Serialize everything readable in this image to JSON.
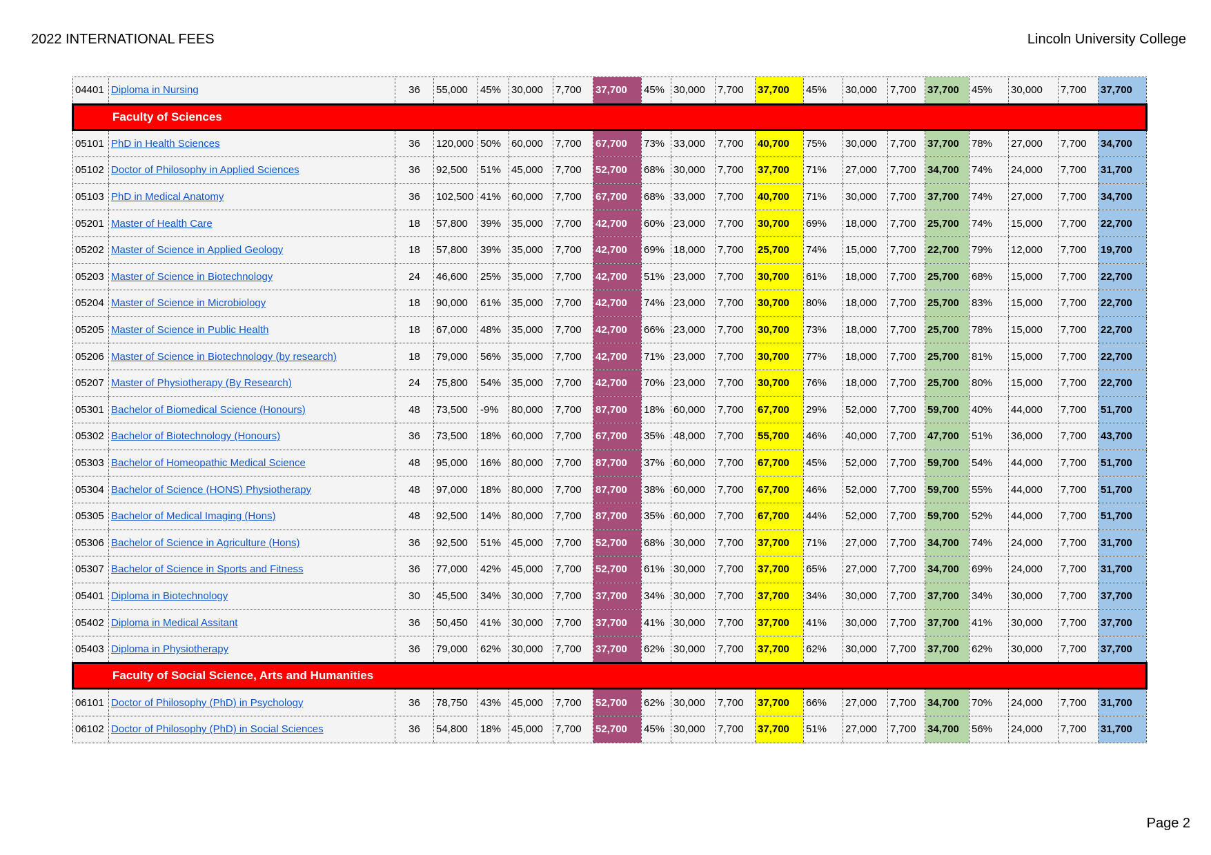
{
  "header": {
    "title": "2022 INTERNATIONAL FEES",
    "institution": "Lincoln University College"
  },
  "footer": {
    "page": "Page 2"
  },
  "rows": [
    {
      "type": "program",
      "cells": [
        "04401",
        "Diploma in Nursing",
        "36",
        "55,000",
        "45%",
        "30,000",
        "7,700",
        "37,700",
        "45%",
        "30,000",
        "7,700",
        "37,700",
        "45%",
        "30,000",
        "7,700",
        "37,700",
        "45%",
        "30,000",
        "7,700",
        "37,700"
      ]
    },
    {
      "type": "faculty",
      "label": "Faculty of Sciences"
    },
    {
      "type": "program",
      "cells": [
        "05101",
        "PhD in Health Sciences",
        "36",
        "120,000",
        "50%",
        "60,000",
        "7,700",
        "67,700",
        "73%",
        "33,000",
        "7,700",
        "40,700",
        "75%",
        "30,000",
        "7,700",
        "37,700",
        "78%",
        "27,000",
        "7,700",
        "34,700"
      ]
    },
    {
      "type": "program",
      "cells": [
        "05102",
        "Doctor of Philosophy in Applied Sciences",
        "36",
        "92,500",
        "51%",
        "45,000",
        "7,700",
        "52,700",
        "68%",
        "30,000",
        "7,700",
        "37,700",
        "71%",
        "27,000",
        "7,700",
        "34,700",
        "74%",
        "24,000",
        "7,700",
        "31,700"
      ]
    },
    {
      "type": "program",
      "cells": [
        "05103",
        "PhD in Medical Anatomy",
        "36",
        "102,500",
        "41%",
        "60,000",
        "7,700",
        "67,700",
        "68%",
        "33,000",
        "7,700",
        "40,700",
        "71%",
        "30,000",
        "7,700",
        "37,700",
        "74%",
        "27,000",
        "7,700",
        "34,700"
      ]
    },
    {
      "type": "program",
      "cells": [
        "05201",
        "Master of Health Care",
        "18",
        "57,800",
        "39%",
        "35,000",
        "7,700",
        "42,700",
        "60%",
        "23,000",
        "7,700",
        "30,700",
        "69%",
        "18,000",
        "7,700",
        "25,700",
        "74%",
        "15,000",
        "7,700",
        "22,700"
      ]
    },
    {
      "type": "program",
      "cells": [
        "05202",
        "Master of Science in Applied Geology",
        "18",
        "57,800",
        "39%",
        "35,000",
        "7,700",
        "42,700",
        "69%",
        "18,000",
        "7,700",
        "25,700",
        "74%",
        "15,000",
        "7,700",
        "22,700",
        "79%",
        "12,000",
        "7,700",
        "19,700"
      ]
    },
    {
      "type": "program",
      "cells": [
        "05203",
        "Master of Science in Biotechnology",
        "24",
        "46,600",
        "25%",
        "35,000",
        "7,700",
        "42,700",
        "51%",
        "23,000",
        "7,700",
        "30,700",
        "61%",
        "18,000",
        "7,700",
        "25,700",
        "68%",
        "15,000",
        "7,700",
        "22,700"
      ]
    },
    {
      "type": "program",
      "cells": [
        "05204",
        "Master of Science in Microbiology",
        "18",
        "90,000",
        "61%",
        "35,000",
        "7,700",
        "42,700",
        "74%",
        "23,000",
        "7,700",
        "30,700",
        "80%",
        "18,000",
        "7,700",
        "25,700",
        "83%",
        "15,000",
        "7,700",
        "22,700"
      ]
    },
    {
      "type": "program",
      "cells": [
        "05205",
        "Master of Science in Public Health",
        "18",
        "67,000",
        "48%",
        "35,000",
        "7,700",
        "42,700",
        "66%",
        "23,000",
        "7,700",
        "30,700",
        "73%",
        "18,000",
        "7,700",
        "25,700",
        "78%",
        "15,000",
        "7,700",
        "22,700"
      ]
    },
    {
      "type": "program",
      "cells": [
        "05206",
        "Master of Science in Biotechnology (by research)",
        "18",
        "79,000",
        "56%",
        "35,000",
        "7,700",
        "42,700",
        "71%",
        "23,000",
        "7,700",
        "30,700",
        "77%",
        "18,000",
        "7,700",
        "25,700",
        "81%",
        "15,000",
        "7,700",
        "22,700"
      ]
    },
    {
      "type": "program",
      "cells": [
        "05207",
        "Master of Physiotherapy (By Research)",
        "24",
        "75,800",
        "54%",
        "35,000",
        "7,700",
        "42,700",
        "70%",
        "23,000",
        "7,700",
        "30,700",
        "76%",
        "18,000",
        "7,700",
        "25,700",
        "80%",
        "15,000",
        "7,700",
        "22,700"
      ]
    },
    {
      "type": "program",
      "cells": [
        "05301",
        "Bachelor of Biomedical Science (Honours)",
        "48",
        "73,500",
        "-9%",
        "80,000",
        "7,700",
        "87,700",
        "18%",
        "60,000",
        "7,700",
        "67,700",
        "29%",
        "52,000",
        "7,700",
        "59,700",
        "40%",
        "44,000",
        "7,700",
        "51,700"
      ]
    },
    {
      "type": "program",
      "cells": [
        "05302",
        "Bachelor of Biotechnology (Honours)",
        "36",
        "73,500",
        "18%",
        "60,000",
        "7,700",
        "67,700",
        "35%",
        "48,000",
        "7,700",
        "55,700",
        "46%",
        "40,000",
        "7,700",
        "47,700",
        "51%",
        "36,000",
        "7,700",
        "43,700"
      ]
    },
    {
      "type": "program",
      "cells": [
        "05303",
        "Bachelor of Homeopathic Medical Science",
        "48",
        "95,000",
        "16%",
        "80,000",
        "7,700",
        "87,700",
        "37%",
        "60,000",
        "7,700",
        "67,700",
        "45%",
        "52,000",
        "7,700",
        "59,700",
        "54%",
        "44,000",
        "7,700",
        "51,700"
      ]
    },
    {
      "type": "program",
      "cells": [
        "05304",
        "Bachelor of Science (HONS) Physiotherapy",
        "48",
        "97,000",
        "18%",
        "80,000",
        "7,700",
        "87,700",
        "38%",
        "60,000",
        "7,700",
        "67,700",
        "46%",
        "52,000",
        "7,700",
        "59,700",
        "55%",
        "44,000",
        "7,700",
        "51,700"
      ]
    },
    {
      "type": "program",
      "cells": [
        "05305",
        "Bachelor of Medical Imaging (Hons)",
        "48",
        "92,500",
        "14%",
        "80,000",
        "7,700",
        "87,700",
        "35%",
        "60,000",
        "7,700",
        "67,700",
        "44%",
        "52,000",
        "7,700",
        "59,700",
        "52%",
        "44,000",
        "7,700",
        "51,700"
      ]
    },
    {
      "type": "program",
      "cells": [
        "05306",
        "Bachelor of Science in Agriculture (Hons)",
        "36",
        "92,500",
        "51%",
        "45,000",
        "7,700",
        "52,700",
        "68%",
        "30,000",
        "7,700",
        "37,700",
        "71%",
        "27,000",
        "7,700",
        "34,700",
        "74%",
        "24,000",
        "7,700",
        "31,700"
      ]
    },
    {
      "type": "program",
      "cells": [
        "05307",
        "Bachelor of Science in Sports and Fitness",
        "36",
        "77,000",
        "42%",
        "45,000",
        "7,700",
        "52,700",
        "61%",
        "30,000",
        "7,700",
        "37,700",
        "65%",
        "27,000",
        "7,700",
        "34,700",
        "69%",
        "24,000",
        "7,700",
        "31,700"
      ]
    },
    {
      "type": "program",
      "cells": [
        "05401",
        "Diploma in Biotechnology",
        "30",
        "45,500",
        "34%",
        "30,000",
        "7,700",
        "37,700",
        "34%",
        "30,000",
        "7,700",
        "37,700",
        "34%",
        "30,000",
        "7,700",
        "37,700",
        "34%",
        "30,000",
        "7,700",
        "37,700"
      ]
    },
    {
      "type": "program",
      "cells": [
        "05402",
        "Diploma in Medical Assitant",
        "36",
        "50,450",
        "41%",
        "30,000",
        "7,700",
        "37,700",
        "41%",
        "30,000",
        "7,700",
        "37,700",
        "41%",
        "30,000",
        "7,700",
        "37,700",
        "41%",
        "30,000",
        "7,700",
        "37,700"
      ]
    },
    {
      "type": "program",
      "cells": [
        "05403",
        "Diploma in Physiotherapy",
        "36",
        "79,000",
        "62%",
        "30,000",
        "7,700",
        "37,700",
        "62%",
        "30,000",
        "7,700",
        "37,700",
        "62%",
        "30,000",
        "7,700",
        "37,700",
        "62%",
        "30,000",
        "7,700",
        "37,700"
      ]
    },
    {
      "type": "faculty",
      "label": "Faculty of Social Science, Arts and Humanities"
    },
    {
      "type": "program",
      "cells": [
        "06101",
        "Doctor of Philosophy (PhD) in Psychology",
        "36",
        "78,750",
        "43%",
        "45,000",
        "7,700",
        "52,700",
        "62%",
        "30,000",
        "7,700",
        "37,700",
        "66%",
        "27,000",
        "7,700",
        "34,700",
        "70%",
        "24,000",
        "7,700",
        "31,700"
      ]
    },
    {
      "type": "program",
      "cells": [
        "06102",
        "Doctor of Philosophy (PhD) in Social Sciences",
        "36",
        "54,800",
        "18%",
        "45,000",
        "7,700",
        "52,700",
        "45%",
        "30,000",
        "7,700",
        "37,700",
        "51%",
        "27,000",
        "7,700",
        "34,700",
        "56%",
        "24,000",
        "7,700",
        "31,700"
      ]
    }
  ]
}
